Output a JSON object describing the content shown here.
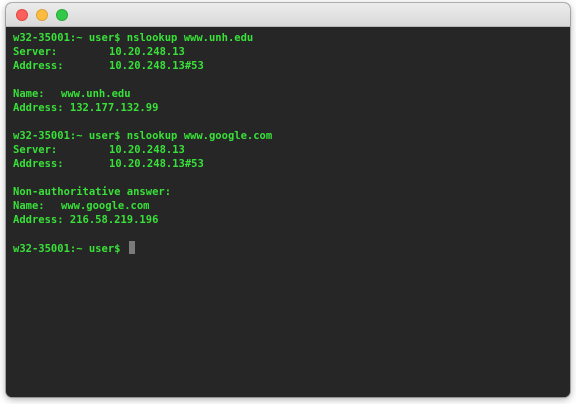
{
  "terminal": {
    "prompt": "w32-35001:~ user$",
    "block1": {
      "command": "nslookup www.unh.edu",
      "server_label": "Server:",
      "server_value": "10.20.248.13",
      "address_label": "Address:",
      "address_value": "10.20.248.13#53",
      "name_label": "Name:",
      "name_value": "www.unh.edu",
      "result_address": "Address: 132.177.132.99"
    },
    "block2": {
      "command": "nslookup www.google.com",
      "server_label": "Server:",
      "server_value": "10.20.248.13",
      "address_label": "Address:",
      "address_value": "10.20.248.13#53",
      "non_auth": "Non-authoritative answer:",
      "name_label": "Name:",
      "name_value": "www.google.com",
      "result_address": "Address: 216.58.219.196"
    }
  },
  "colors": {
    "text": "#39e039",
    "background": "#262626"
  }
}
